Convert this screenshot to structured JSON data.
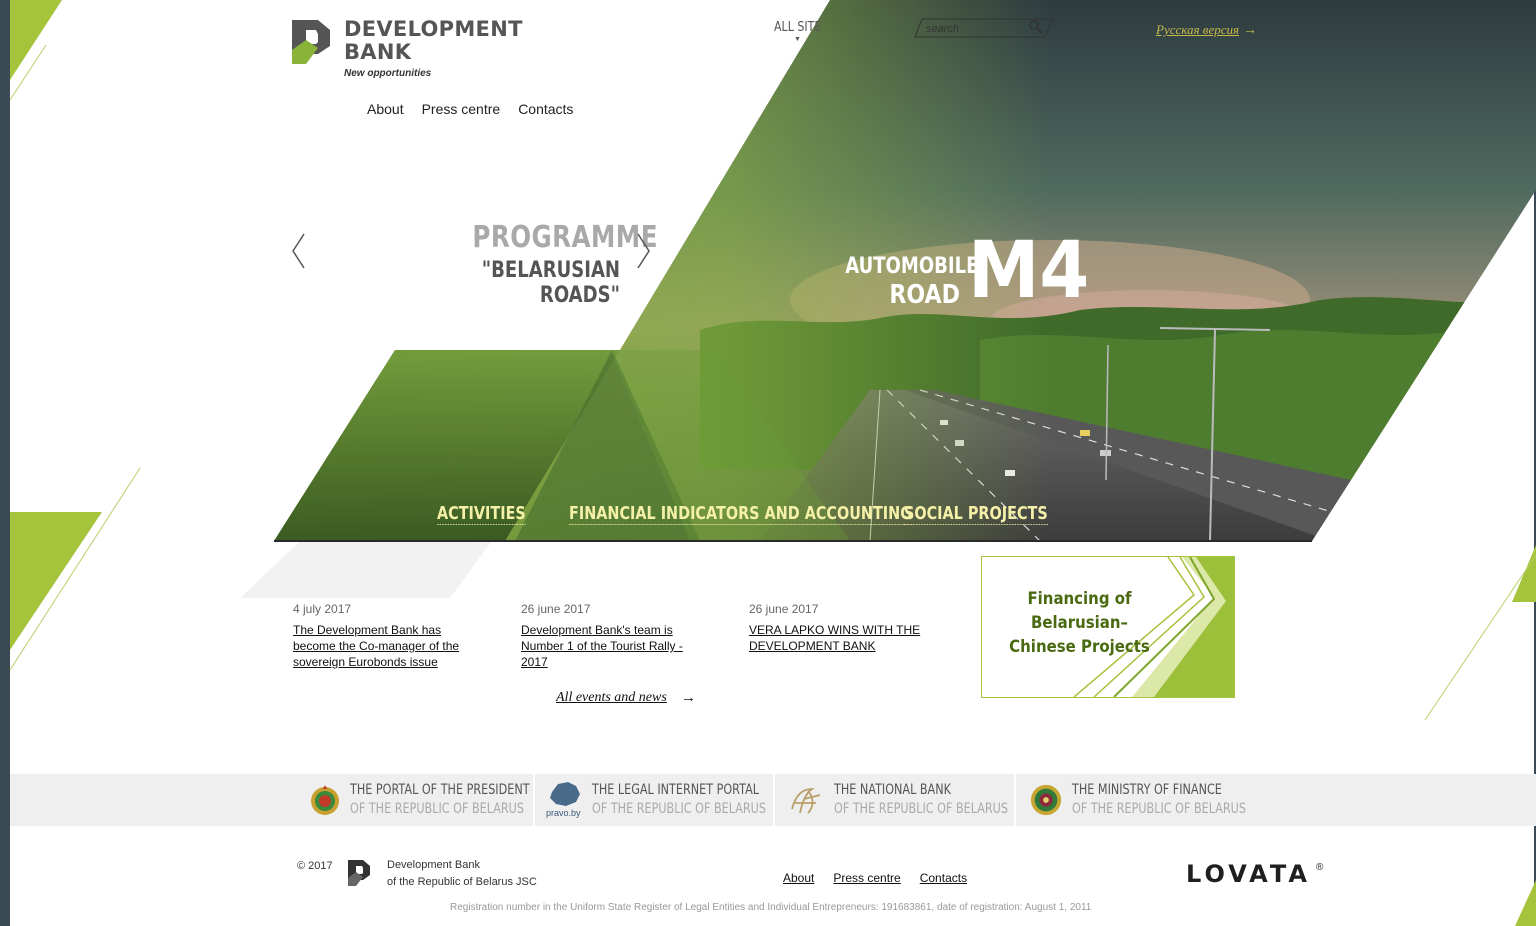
{
  "header": {
    "logo": {
      "line1": "DEVELOPMENT",
      "line2": "BANK",
      "tagline": "New opportunities"
    },
    "nav": [
      "About",
      "Press centre",
      "Contacts"
    ],
    "all_site": "ALL SITE",
    "search": {
      "placeholder": "search"
    },
    "lang_link": "Русская версия",
    "lang_arrow": "→"
  },
  "hero": {
    "programme_line1": "PROGRAMME",
    "programme_line2": "\"BELARUSIAN ROADS\"",
    "banner_line1": "AUTOMOBILE",
    "banner_line2": "ROAD",
    "banner_big": "M4",
    "links": [
      "ACTIVITIES",
      "FINANCIAL INDICATORS AND ACCOUNTING",
      "SOCIAL PROJECTS"
    ]
  },
  "news": {
    "items": [
      {
        "date": "4 july 2017",
        "title": "The Development Bank has become the Co-manager of the sovereign Eurobonds issue"
      },
      {
        "date": "26 june 2017",
        "title": "Development Bank's team is Number 1 of the Tourist Rally - 2017"
      },
      {
        "date": "26 june 2017",
        "title": "VERA LAPKO WINS WITH THE DEVELOPMENT BANK"
      }
    ],
    "all_link": "All events and news",
    "all_arrow": "→"
  },
  "promo": {
    "text": "Financing of Belarusian–Chinese Projects"
  },
  "partners": [
    {
      "line1": "THE PORTAL OF THE PRESIDENT",
      "line2": "OF THE REPUBLIC OF BELARUS",
      "icon": "state-emblem-icon"
    },
    {
      "line1": "THE LEGAL INTERNET PORTAL",
      "line2": "OF THE REPUBLIC OF BELARUS",
      "icon": "pravo-by-icon",
      "icon_label": "pravo.by"
    },
    {
      "line1": "THE NATIONAL BANK",
      "line2": "OF THE REPUBLIC OF BELARUS",
      "icon": "national-bank-monogram-icon"
    },
    {
      "line1": "THE MINISTRY OF FINANCE",
      "line2": "OF THE REPUBLIC OF BELARUS",
      "icon": "ministry-emblem-icon"
    }
  ],
  "footer": {
    "copyright": "© 2017",
    "org_line1": "Development Bank",
    "org_line2": "of the Republic of Belarus JSC",
    "nav": [
      "About",
      "Press centre",
      "Contacts"
    ],
    "developer": "LOVATA",
    "developer_mark": "®",
    "registration": "Registration number in the Uniform State Register of Legal Entities and Individual Entrepreneurs: 191683861, date of registration: August 1, 2011"
  },
  "colors": {
    "accent_green": "#a6c33c",
    "dark_green": "#4a6a12",
    "link_yellow": "#f5f0a8",
    "lang_link": "#c6b94a"
  }
}
